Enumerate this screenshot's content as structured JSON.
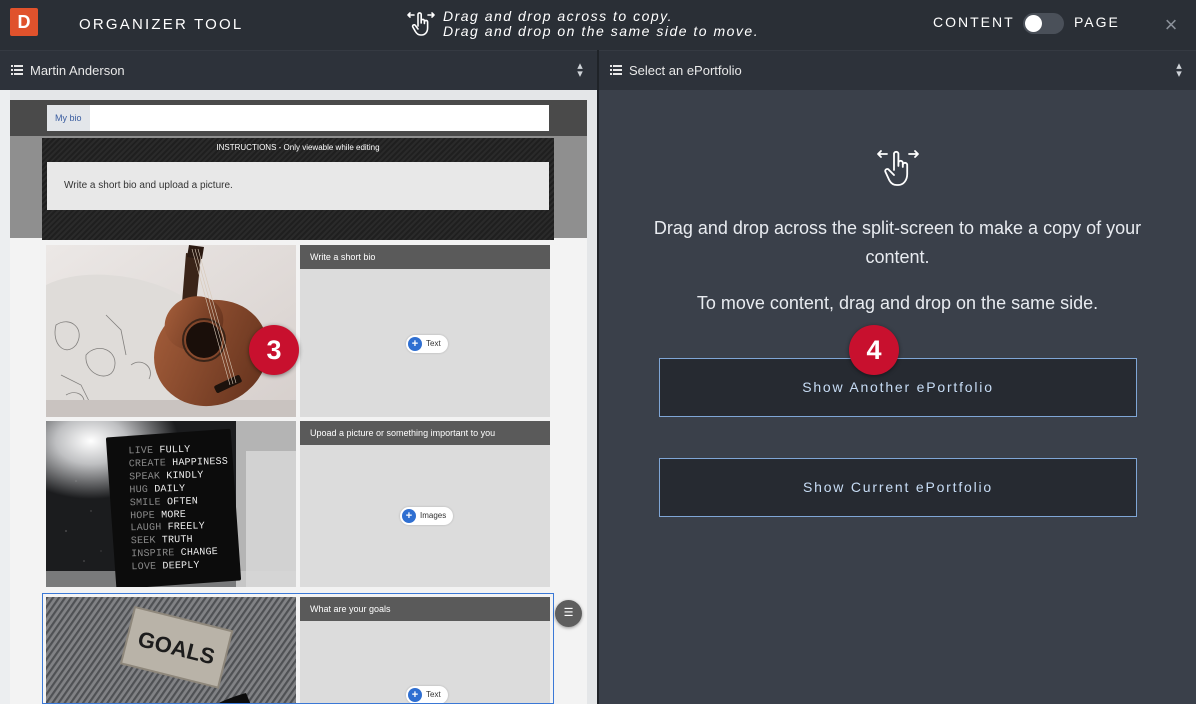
{
  "topbar": {
    "logo": "D",
    "title": "ORGANIZER TOOL",
    "instruction_line1": "Drag and drop across to copy.",
    "instruction_line2": "Drag and drop on the same side to move.",
    "mode_left": "CONTENT",
    "mode_right": "PAGE",
    "mode_selected": "CONTENT",
    "close": "×"
  },
  "left_selector": {
    "label": "Martin Anderson"
  },
  "right_selector": {
    "label": "Select an ePortfolio"
  },
  "left_page": {
    "tab": "My bio",
    "instructions_caption": "INSTRUCTIONS - Only viewable while editing",
    "instructions_text": "Write a short bio and upload a picture.",
    "sections": [
      {
        "title": "Write a short bio",
        "add_label": "Text",
        "image": "guitar-photo"
      },
      {
        "title": "Upoad a picture or something important to you",
        "add_label": "Images",
        "image": "letterboard-photo"
      },
      {
        "title": "What are your goals",
        "add_label": "Text",
        "image": "goals-patch-photo"
      }
    ],
    "letterboard_lines": [
      [
        "LIVE",
        "FULLY"
      ],
      [
        "CREATE",
        "HAPPINESS"
      ],
      [
        "SPEAK",
        "KINDLY"
      ],
      [
        "HUG",
        "DAILY"
      ],
      [
        "SMILE",
        "OFTEN"
      ],
      [
        "HOPE",
        "MORE"
      ],
      [
        "LAUGH",
        "FREELY"
      ],
      [
        "SEEK",
        "TRUTH"
      ],
      [
        "INSPIRE",
        "CHANGE"
      ],
      [
        "LOVE",
        "DEEPLY"
      ]
    ],
    "goals_patch_text": "GOALS"
  },
  "callouts": {
    "left": "3",
    "right": "4"
  },
  "right_panel": {
    "message1": "Drag and drop across the split-screen to make a copy of your content.",
    "message2": "To move content, drag and drop on the same side.",
    "button_another": "Show Another ePortfolio",
    "button_current": "Show Current ePortfolio"
  },
  "colors": {
    "topbar_bg": "#2a2f36",
    "right_bg": "#3a404a",
    "button_border": "#7fa6d6",
    "badge_red": "#c8102e",
    "logo_orange": "#e0522c",
    "add_blue": "#2f6fd1"
  }
}
